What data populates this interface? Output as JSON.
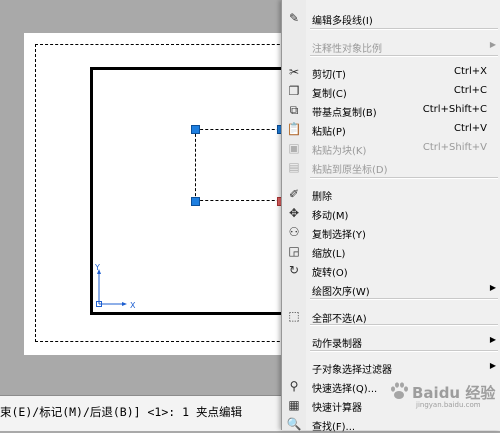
{
  "command_line": {
    "text": "束(E)/标记(M)/后退(B)] <1>: 1 夹点编辑"
  },
  "ucs": {
    "y_label": "Y",
    "x_label": "X"
  },
  "context_menu": {
    "items": [
      {
        "label": "编辑多段线(I)",
        "shortcut": "",
        "icon": "polyline-edit-icon",
        "enabled": true,
        "submenu": false
      },
      {
        "label": "注释性对象比例",
        "shortcut": "",
        "icon": "",
        "enabled": false,
        "submenu": true
      },
      {
        "label": "剪切(T)",
        "shortcut": "Ctrl+X",
        "icon": "cut-icon",
        "enabled": true,
        "submenu": false
      },
      {
        "label": "复制(C)",
        "shortcut": "Ctrl+C",
        "icon": "copy-icon",
        "enabled": true,
        "submenu": false
      },
      {
        "label": "带基点复制(B)",
        "shortcut": "Ctrl+Shift+C",
        "icon": "copy-base-point-icon",
        "enabled": true,
        "submenu": false
      },
      {
        "label": "粘贴(P)",
        "shortcut": "Ctrl+V",
        "icon": "paste-icon",
        "enabled": true,
        "submenu": false
      },
      {
        "label": "粘贴为块(K)",
        "shortcut": "Ctrl+Shift+V",
        "icon": "paste-block-icon",
        "enabled": false,
        "submenu": false
      },
      {
        "label": "粘贴到原坐标(D)",
        "shortcut": "",
        "icon": "paste-original-coords-icon",
        "enabled": false,
        "submenu": false
      },
      {
        "label": "删除",
        "shortcut": "",
        "icon": "erase-icon",
        "enabled": true,
        "submenu": false
      },
      {
        "label": "移动(M)",
        "shortcut": "",
        "icon": "move-icon",
        "enabled": true,
        "submenu": false
      },
      {
        "label": "复制选择(Y)",
        "shortcut": "",
        "icon": "copy-selection-icon",
        "enabled": true,
        "submenu": false
      },
      {
        "label": "缩放(L)",
        "shortcut": "",
        "icon": "scale-icon",
        "enabled": true,
        "submenu": false
      },
      {
        "label": "旋转(O)",
        "shortcut": "",
        "icon": "rotate-icon",
        "enabled": true,
        "submenu": false
      },
      {
        "label": "绘图次序(W)",
        "shortcut": "",
        "icon": "",
        "enabled": true,
        "submenu": true
      },
      {
        "label": "全部不选(A)",
        "shortcut": "",
        "icon": "deselect-all-icon",
        "enabled": true,
        "submenu": false
      },
      {
        "label": "动作录制器",
        "shortcut": "",
        "icon": "",
        "enabled": true,
        "submenu": true
      },
      {
        "label": "子对象选择过滤器",
        "shortcut": "",
        "icon": "",
        "enabled": true,
        "submenu": true
      },
      {
        "label": "快速选择(Q)...",
        "shortcut": "",
        "icon": "quick-select-icon",
        "enabled": true,
        "submenu": false
      },
      {
        "label": "快速计算器",
        "shortcut": "",
        "icon": "calculator-icon",
        "enabled": true,
        "submenu": false
      },
      {
        "label": "查找(F)...",
        "shortcut": "",
        "icon": "find-icon",
        "enabled": true,
        "submenu": false
      }
    ]
  },
  "watermark": {
    "text": "Baidu 经验",
    "sub": "jingyan.baidu.com"
  },
  "colors": {
    "grip": "#1e7fe0",
    "menu_bg": "#f0f0f0",
    "canvas_bg": "#a9a9a9"
  }
}
